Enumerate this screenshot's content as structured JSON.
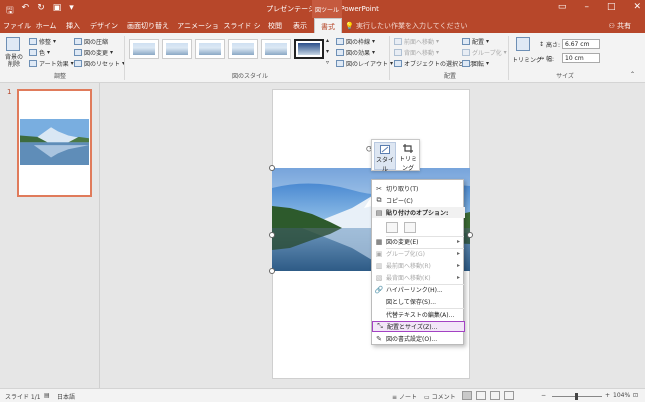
{
  "window": {
    "title": "プレゼンテーション1 - PowerPoint",
    "context_tab_group": "図ツール",
    "share": "共有",
    "tell_me": "実行したい作業を入力してください"
  },
  "tabs": [
    "ファイル",
    "ホーム",
    "挿入",
    "デザイン",
    "画面切り替え",
    "アニメーション",
    "スライド ショー",
    "校閲",
    "表示",
    "書式"
  ],
  "ribbon": {
    "adjust": {
      "remove_bg": "背景の削除",
      "corrections": "修整",
      "color": "色",
      "artistic": "アート効果",
      "compress": "図の圧縮",
      "change": "図の変更",
      "reset": "図のリセット",
      "label": "調整"
    },
    "styles": {
      "border": "図の枠線",
      "effects": "図の効果",
      "layout": "図のレイアウト",
      "label": "図のスタイル"
    },
    "arrange": {
      "bring_forward": "前面へ移動",
      "send_backward": "背面へ移動",
      "selection_pane": "オブジェクトの選択と表示",
      "align": "配置",
      "group": "グループ化",
      "rotate": "回転",
      "label": "配置"
    },
    "size": {
      "crop": "トリミング",
      "height_label": "高さ:",
      "height": "6.67 cm",
      "width_label": "幅:",
      "width": "10 cm",
      "label": "サイズ"
    }
  },
  "slides_panel": {
    "slide_number": "1"
  },
  "mini_toolbar": {
    "style": "スタイル",
    "crop": "トリミング"
  },
  "context_menu": {
    "items": [
      {
        "icon": "✂",
        "label": "切り取り(T)"
      },
      {
        "icon": "⧉",
        "label": "コピー(C)"
      },
      {
        "icon": "▤",
        "label": "貼り付けのオプション:"
      },
      {
        "icon": "▦",
        "label": "図の変更(E)",
        "arrow": "▸"
      },
      {
        "icon": "▣",
        "label": "グループ化(G)",
        "arrow": "▸"
      },
      {
        "icon": "▥",
        "label": "最前面へ移動(R)",
        "arrow": "▸"
      },
      {
        "icon": "▧",
        "label": "最背面へ移動(K)",
        "arrow": "▸"
      },
      {
        "icon": "🔗",
        "label": "ハイパーリンク(H)..."
      },
      {
        "icon": "",
        "label": "図として保存(S)..."
      },
      {
        "icon": "",
        "label": "代替テキストの編集(A)..."
      },
      {
        "icon": "⤡",
        "label": "配置とサイズ(Z)..."
      },
      {
        "icon": "✎",
        "label": "図の書式設定(O)..."
      }
    ]
  },
  "status": {
    "slide": "スライド 1/1",
    "language": "日本語",
    "notes": "ノート",
    "comments": "コメント",
    "zoom": "104%"
  }
}
